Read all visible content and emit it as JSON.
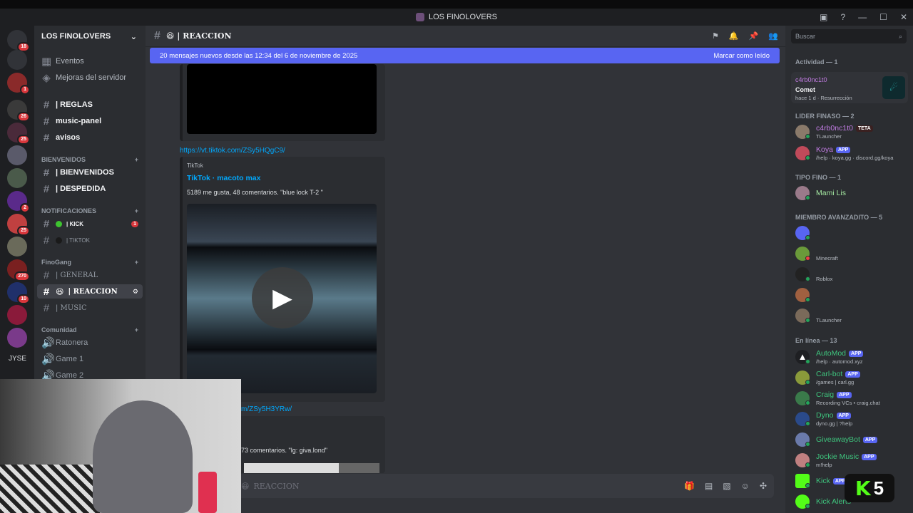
{
  "window": {
    "title": "LOS FINOLOVERS"
  },
  "server": {
    "name": "LOS FINOLOVERS",
    "badges": [
      "18",
      "1",
      "26",
      "25",
      "2",
      "25",
      "270",
      "10"
    ],
    "initials": "JYSE"
  },
  "channels": {
    "top": [
      {
        "label": "Eventos",
        "icon": "calendar-icon"
      },
      {
        "label": "Mejoras del servidor",
        "icon": "boost-icon"
      }
    ],
    "list1": [
      {
        "label": "| REGLAS"
      },
      {
        "label": "music-panel"
      },
      {
        "label": "avisos"
      }
    ],
    "cat_bienvenidos": "BIENVENIDOS",
    "list2": [
      {
        "label": "| BIENVENIDOS"
      },
      {
        "label": "| DESPEDIDA"
      }
    ],
    "cat_notif": "NOTIFICACIONES",
    "kick": "| KICK",
    "kick_badge": "1",
    "tiktok": "| TIKTOK",
    "cat_finogang": "FinoGang",
    "general": "| GENERAL",
    "reaccion": "| REACCION",
    "music": "| MUSIC",
    "cat_comunidad": "Comunidad",
    "voice": [
      {
        "label": "Ratonera"
      },
      {
        "label": "Game 1"
      },
      {
        "label": "Game 2"
      }
    ]
  },
  "header": {
    "channel": "| REACCION"
  },
  "newbar": {
    "text": "20 mensajes nuevos desde las 12:34 del 6 de noviembre de 2025",
    "action": "Marcar como leído"
  },
  "messages": {
    "link1": "https://vt.tiktok.com/ZSy5HQgC9/",
    "provider": "TikTok",
    "embed_title": "TikTok · macoto max",
    "embed_desc": "5189 me gusta, 48 comentarios. \"blue lock T-2 \"",
    "link2": "m/ZSy5H3YRw/",
    "desc2": "73 comentarios. \"lg: giva.lond\""
  },
  "composer": {
    "placeholder": "REACCION"
  },
  "search": {
    "placeholder": "Buscar"
  },
  "members": {
    "activity_head": "Actividad — 1",
    "activity": {
      "name": "c4rb0nc1t0",
      "game": "Comet",
      "time": "hace 1 d",
      "status": "Resurrección"
    },
    "groups": [
      {
        "head": "LIDER FINASO — 2",
        "users": [
          {
            "name": "c4rb0nc1t0",
            "tag": "TETA",
            "status": "TLauncher",
            "color": "#c27ce3"
          },
          {
            "name": "Koya",
            "tag": "APP",
            "status": "/help · koya.gg · discord.gg/koya",
            "color": "#c27ce3"
          }
        ]
      },
      {
        "head": "TIPO FINO — 1",
        "users": [
          {
            "name": "Mami Lis",
            "color": "#a3e6a0"
          }
        ]
      },
      {
        "head": "MIEMBRO AVANZADITO — 5",
        "users": [
          {
            "name": "",
            "color": "#b0185a"
          },
          {
            "name": "",
            "status": "Minecraft",
            "color": "#b0185a"
          },
          {
            "name": "",
            "status": "Roblox",
            "color": "#b0185a"
          },
          {
            "name": "",
            "color": "#b0185a"
          },
          {
            "name": "",
            "status": "TLauncher",
            "color": "#b0185a"
          }
        ]
      },
      {
        "head": "En línea — 13",
        "users": [
          {
            "name": "AutoMod",
            "tag": "APP",
            "status": "/help · automod.xyz",
            "color": "#3ec47d"
          },
          {
            "name": "Carl-bot",
            "tag": "APP",
            "status": "/games | carl.gg",
            "color": "#3ec47d"
          },
          {
            "name": "Craig",
            "tag": "APP",
            "status": "Recording VCs • craig.chat",
            "color": "#3ec47d"
          },
          {
            "name": "Dyno",
            "tag": "APP",
            "status": "dyno.gg | ?help",
            "color": "#3ec47d"
          },
          {
            "name": "GiveawayBot",
            "tag": "APP",
            "color": "#3ec47d"
          },
          {
            "name": "Jockie Music",
            "tag": "APP",
            "status": "m!help",
            "color": "#3ec47d"
          },
          {
            "name": "Kick",
            "tag": "APP",
            "color": "#3ec47d"
          },
          {
            "name": "Kick Alerts",
            "color": "#3ec47d"
          }
        ]
      }
    ]
  },
  "overlay": {
    "k5": "5"
  }
}
